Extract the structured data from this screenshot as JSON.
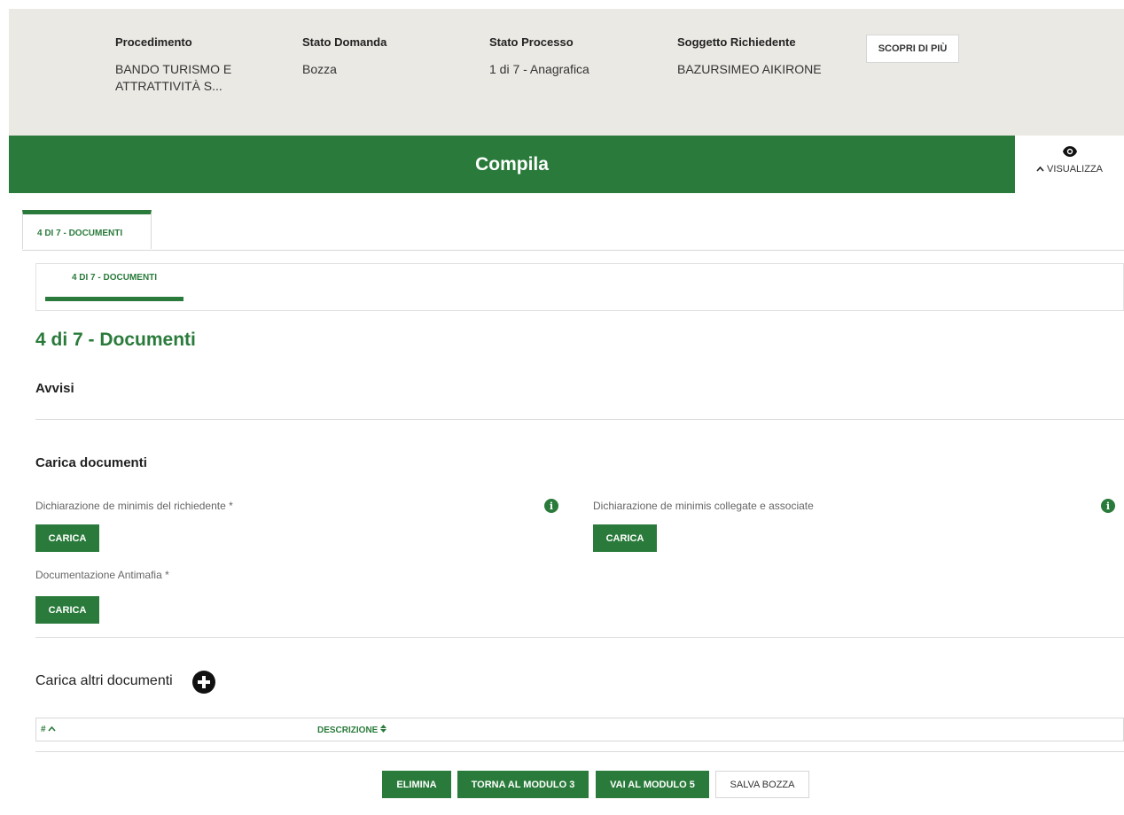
{
  "header": {
    "procedimento_label": "Procedimento",
    "procedimento_value": "BANDO TURISMO E ATTRATTIVITÀ S...",
    "stato_domanda_label": "Stato Domanda",
    "stato_domanda_value": "Bozza",
    "stato_processo_label": "Stato Processo",
    "stato_processo_value": "1 di 7 - Anagrafica",
    "soggetto_label": "Soggetto Richiedente",
    "soggetto_value": "BAZURSIMEO AIKIRONE",
    "scopri_button": "SCOPRI DI PIÙ"
  },
  "banner": {
    "title": "Compila",
    "visualizza_label": "VISUALIZZA"
  },
  "tabs": {
    "main_tab": "4 DI 7 - DOCUMENTI",
    "sub_tab": "4 DI 7 - DOCUMENTI"
  },
  "page": {
    "title": "4 di 7 - Documenti",
    "avvisi": "Avvisi"
  },
  "upload": {
    "section_title": "Carica documenti",
    "fields": [
      {
        "label": "Dichiarazione de minimis del richiedente *",
        "button": "CARICA"
      },
      {
        "label": "Dichiarazione de minimis collegate e associate",
        "button": "CARICA"
      },
      {
        "label": "Documentazione Antimafia *",
        "button": "CARICA"
      }
    ]
  },
  "altri": {
    "section_title": "Carica altri documenti",
    "table_headers": [
      "#",
      "DESCRIZIONE"
    ]
  },
  "footer": {
    "elimina": "ELIMINA",
    "torna": "TORNA AL MODULO 3",
    "vai": "VAI AL MODULO 5",
    "salva": "SALVA BOZZA"
  },
  "colors": {
    "primary_green": "#2a7b3b",
    "header_bg": "#ebe9e4"
  }
}
